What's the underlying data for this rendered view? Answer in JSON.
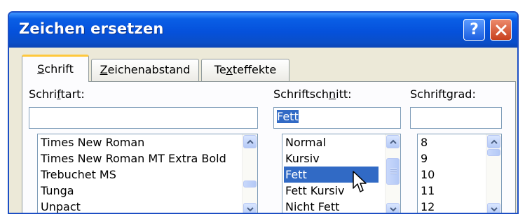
{
  "window": {
    "title": "Zeichen ersetzen"
  },
  "titlebar": {
    "help_glyph": "?",
    "close_glyph": "✕"
  },
  "tabs": [
    {
      "pre": "",
      "u": "S",
      "post": "chrift",
      "active": true
    },
    {
      "pre": "",
      "u": "Z",
      "post": "eichenabstand",
      "active": false
    },
    {
      "pre": "Te",
      "u": "x",
      "post": "teffekte",
      "active": false
    }
  ],
  "font": {
    "label_pre": "Schri",
    "label_u": "f",
    "label_post": "tart:",
    "value": "",
    "items": [
      "Times New Roman",
      "Times New Roman MT Extra Bold",
      "Trebuchet MS",
      "Tunga",
      "Unpact"
    ]
  },
  "style": {
    "label_pre": "Schriftsch",
    "label_u": "n",
    "label_post": "itt:",
    "value": "Fett",
    "items": [
      "Normal",
      "Kursiv",
      "Fett",
      "Fett Kursiv",
      "Nicht Fett"
    ],
    "selected": "Fett"
  },
  "size": {
    "label_pre": "Schrift",
    "label_u": "g",
    "label_post": "rad:",
    "value": "",
    "items": [
      "8",
      "9",
      "10",
      "11",
      "12"
    ]
  }
}
